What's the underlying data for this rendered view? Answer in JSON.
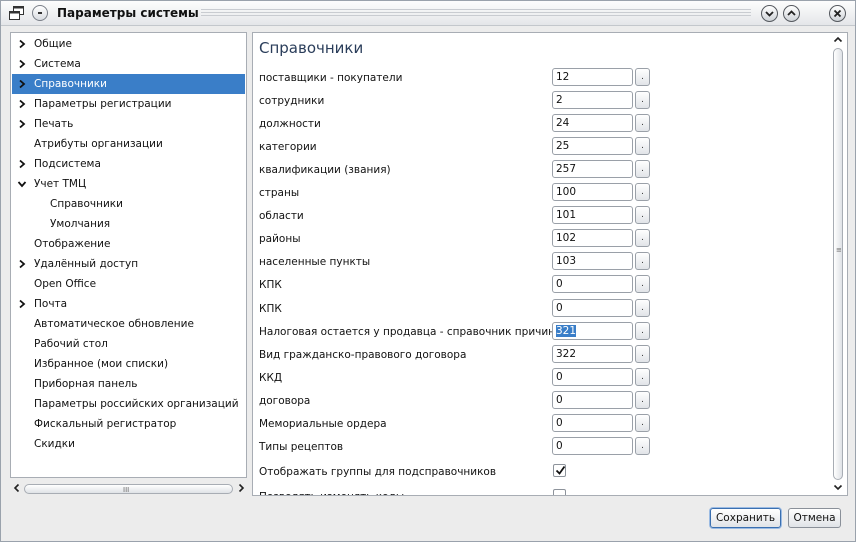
{
  "window": {
    "title": "Параметры системы"
  },
  "icons": {
    "app": "windows-icon",
    "menu": "window-menu-icon",
    "minimize": "chevron-down-icon",
    "maximize": "chevron-up-icon",
    "close": "close-icon",
    "expand": "chevron-right-icon",
    "collapse": "chevron-down-icon",
    "check": "check-icon"
  },
  "colors": {
    "selection": "#3a7ec8",
    "title_text": "#2a3d5a"
  },
  "tree": {
    "items": [
      {
        "label": "Общие",
        "arrow": "right",
        "child": false,
        "selected": false
      },
      {
        "label": "Система",
        "arrow": "right",
        "child": false,
        "selected": false
      },
      {
        "label": "Справочники",
        "arrow": "right",
        "child": false,
        "selected": true
      },
      {
        "label": "Параметры регистрации",
        "arrow": "right",
        "child": false,
        "selected": false
      },
      {
        "label": "Печать",
        "arrow": "right",
        "child": false,
        "selected": false
      },
      {
        "label": "Атрибуты организации",
        "arrow": "",
        "child": false,
        "selected": false
      },
      {
        "label": "Подсистема",
        "arrow": "right",
        "child": false,
        "selected": false
      },
      {
        "label": "Учет ТМЦ",
        "arrow": "down",
        "child": false,
        "selected": false
      },
      {
        "label": "Справочники",
        "arrow": "",
        "child": true,
        "selected": false
      },
      {
        "label": "Умолчания",
        "arrow": "",
        "child": true,
        "selected": false
      },
      {
        "label": "Отображение",
        "arrow": "",
        "child": false,
        "selected": false
      },
      {
        "label": "Удалённый доступ",
        "arrow": "right",
        "child": false,
        "selected": false
      },
      {
        "label": "Open Office",
        "arrow": "",
        "child": false,
        "selected": false
      },
      {
        "label": "Почта",
        "arrow": "right",
        "child": false,
        "selected": false
      },
      {
        "label": "Автоматическое обновление",
        "arrow": "",
        "child": false,
        "selected": false
      },
      {
        "label": "Рабочий стол",
        "arrow": "",
        "child": false,
        "selected": false
      },
      {
        "label": "Избранное (мои списки)",
        "arrow": "",
        "child": false,
        "selected": false
      },
      {
        "label": "Приборная панель",
        "arrow": "",
        "child": false,
        "selected": false
      },
      {
        "label": "Параметры российских организаций",
        "arrow": "",
        "child": false,
        "selected": false
      },
      {
        "label": "Фискальный регистратор",
        "arrow": "",
        "child": false,
        "selected": false
      },
      {
        "label": "Скидки",
        "arrow": "",
        "child": false,
        "selected": false
      }
    ]
  },
  "main": {
    "title": "Справочники",
    "browse_label": ".",
    "fields": [
      {
        "label": "поставщики - покупатели",
        "value": "12"
      },
      {
        "label": "сотрудники",
        "value": "2"
      },
      {
        "label": "должности",
        "value": "24"
      },
      {
        "label": "категории",
        "value": "25"
      },
      {
        "label": "квалификации (звания)",
        "value": "257"
      },
      {
        "label": "страны",
        "value": "100"
      },
      {
        "label": "области",
        "value": "101"
      },
      {
        "label": "районы",
        "value": "102"
      },
      {
        "label": "населенные пункты",
        "value": "103"
      },
      {
        "label": "КПК",
        "value": "0"
      },
      {
        "label": "КПК",
        "value": "0"
      },
      {
        "label": "Налоговая остается у продавца - справочник причин",
        "value": "321",
        "selected": true
      },
      {
        "label": "Вид гражданско-правового договора",
        "value": "322"
      },
      {
        "label": "ККД",
        "value": "0"
      },
      {
        "label": "договора",
        "value": "0"
      },
      {
        "label": "Мемориальные ордера",
        "value": "0"
      },
      {
        "label": "Типы рецептов",
        "value": "0"
      }
    ],
    "checkboxes": [
      {
        "label": "Отображать группы для подсправочников",
        "checked": true
      },
      {
        "label": "Позволять изменять коды",
        "checked": false
      }
    ]
  },
  "scroll": {
    "grip": "III"
  },
  "footer": {
    "save_label": "Сохранить",
    "cancel_label": "Отмена"
  }
}
